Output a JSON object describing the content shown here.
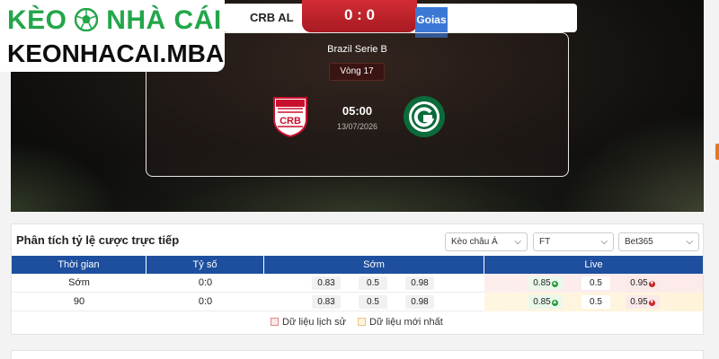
{
  "site": {
    "logo_line1_a": "KÈO",
    "logo_line1_b": "NHÀ CÁI",
    "logo_line2": "KEONHACAI.MBA"
  },
  "match": {
    "home_team": "CRB AL",
    "away_team": "Goias",
    "score": "0 : 0",
    "league": "Brazil Serie B",
    "round": "Vòng 17",
    "kickoff_time": "05:00",
    "kickoff_date": "13/07/2026",
    "home_logo_text": "CRB"
  },
  "odds": {
    "title": "Phân tích tỷ lệ cược trực tiếp",
    "filters": {
      "market": "Kèo châu Á",
      "period": "FT",
      "bookmaker": "Bet365"
    },
    "columns": [
      "Thời gian",
      "Tỷ số",
      "Sớm",
      "Live"
    ],
    "rows": [
      {
        "time": "Sớm",
        "score": "0:0",
        "early": [
          "0.83",
          "0.5",
          "0.98"
        ],
        "live": [
          "0.85",
          "0.5",
          "0.95"
        ]
      },
      {
        "time": "90",
        "score": "0:0",
        "early": [
          "0.83",
          "0.5",
          "0.98"
        ],
        "live": [
          "0.85",
          "0.5",
          "0.95"
        ]
      }
    ],
    "legend": {
      "history": "Dữ liệu lịch sử",
      "latest": "Dữ liệu mới nhất"
    }
  },
  "colors": {
    "accent_red": "#d22c34",
    "table_header": "#1d4f9e",
    "brand_green": "#23a64a",
    "away_blue": "#3b78d6"
  },
  "icons": {
    "ball": "soccer-ball-icon",
    "select_arrow": "chevron-down-icon",
    "odds_up": "arrow-up-icon",
    "odds_down": "arrow-down-icon"
  }
}
